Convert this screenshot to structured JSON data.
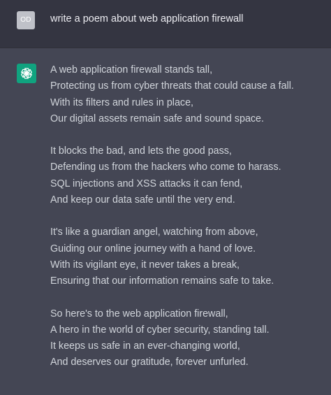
{
  "user_message": {
    "avatar_initials": "OD",
    "text": "write a poem about web application firewall"
  },
  "assistant_message": {
    "avatar_icon": "openai-logo-icon",
    "stanzas": [
      [
        "A web application firewall stands tall,",
        "Protecting us from cyber threats that could cause a fall.",
        "With its filters and rules in place,",
        "Our digital assets remain safe and sound space."
      ],
      [
        "It blocks the bad, and lets the good pass,",
        "Defending us from the hackers who come to harass.",
        "SQL injections and XSS attacks it can fend,",
        "And keep our data safe until the very end."
      ],
      [
        "It's like a guardian angel, watching from above,",
        "Guiding our online journey with a hand of love.",
        "With its vigilant eye, it never takes a break,",
        "Ensuring that our information remains safe to take."
      ],
      [
        "So here's to the web application firewall,",
        "A hero in the world of cyber security, standing tall.",
        "It keeps us safe in an ever-changing world,",
        "And deserves our gratitude, forever unfurled."
      ]
    ]
  },
  "colors": {
    "user_bg": "#343541",
    "assistant_bg": "#444654",
    "assistant_avatar_bg": "#10a37f",
    "user_avatar_bg": "#bfc1c8",
    "text": "#d1d5db"
  }
}
